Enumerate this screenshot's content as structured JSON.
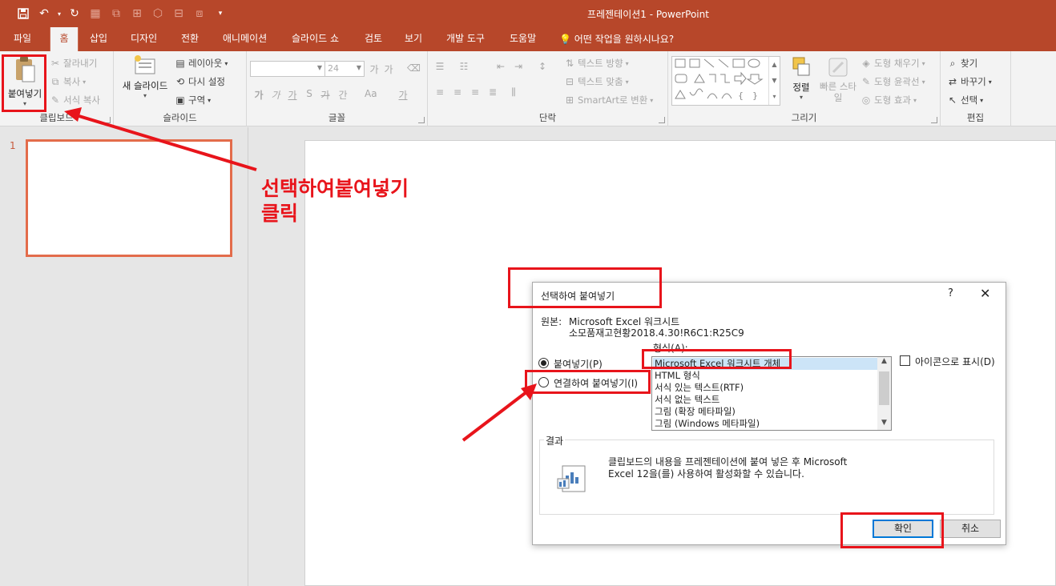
{
  "window": {
    "title": "프레젠테이션1 - PowerPoint"
  },
  "quick_access": [
    "save-icon",
    "undo-icon",
    "redo-icon",
    "customize-icon"
  ],
  "tabs": [
    {
      "label": "파일"
    },
    {
      "label": "홈",
      "active": true
    },
    {
      "label": "삽입"
    },
    {
      "label": "디자인"
    },
    {
      "label": "전환"
    },
    {
      "label": "애니메이션"
    },
    {
      "label": "슬라이드 쇼"
    },
    {
      "label": "검토"
    },
    {
      "label": "보기"
    },
    {
      "label": "개발 도구"
    },
    {
      "label": "도움말"
    }
  ],
  "tell_me": "어떤 작업을 원하시나요?",
  "ribbon": {
    "clipboard": {
      "paste": "붙여넣기",
      "cut": "잘라내기",
      "copy": "복사",
      "format_painter": "서식 복사",
      "label": "클립보드"
    },
    "slides": {
      "new_slide": "새 슬라이드",
      "layout": "레이아웃",
      "reset": "다시 설정",
      "section": "구역",
      "label": "슬라이드"
    },
    "font": {
      "label": "글꼴"
    },
    "paragraph": {
      "text_direction": "텍스트 방향",
      "align_text": "텍스트 맞춤",
      "smartart": "SmartArt로 변환",
      "label": "단락"
    },
    "drawing": {
      "arrange": "정렬",
      "quick_styles": "빠른 스타일",
      "shape_fill": "도형 채우기",
      "shape_outline": "도형 윤곽선",
      "shape_effects": "도형 효과",
      "label": "그리기"
    },
    "editing": {
      "find": "찾기",
      "replace": "바꾸기",
      "select": "선택",
      "label": "편집"
    }
  },
  "slides_panel": {
    "slide_number": "1"
  },
  "dialog": {
    "title": "선택하여 붙여넣기",
    "help": "?",
    "close": "✕",
    "source_label": "원본:",
    "source_line1": "Microsoft Excel 워크시트",
    "source_line2": "소모품재고현황2018.4.30!R6C1:R25C9",
    "format_label": "형식(A):",
    "paste_option": "붙여넣기(P)",
    "paste_link_option": "연결하여 붙여넣기(I)",
    "selected_option": "paste",
    "formats": [
      "Microsoft Excel 워크시트 개체",
      "HTML 형식",
      "서식 있는 텍스트(RTF)",
      "서식 없는 텍스트",
      "그림 (확장 메타파일)",
      "그림 (Windows 메타파일)"
    ],
    "selected_format": "Microsoft Excel 워크시트 개체",
    "display_as_icon": "아이콘으로 표시(D)",
    "result_label": "결과",
    "result_text_line1": "클립보드의 내용을 프레젠테이션에 붙여 넣은 후 Microsoft",
    "result_text_line2": "Excel 12을(를) 사용하여 활성화할 수 있습니다.",
    "ok": "확인",
    "cancel": "취소"
  },
  "annotation": {
    "line1": "선택하여붙여넣기",
    "line2": "클릭",
    "color": "#e8141b"
  },
  "colors": {
    "accent": "#b7472a",
    "annotation": "#e8141b"
  }
}
